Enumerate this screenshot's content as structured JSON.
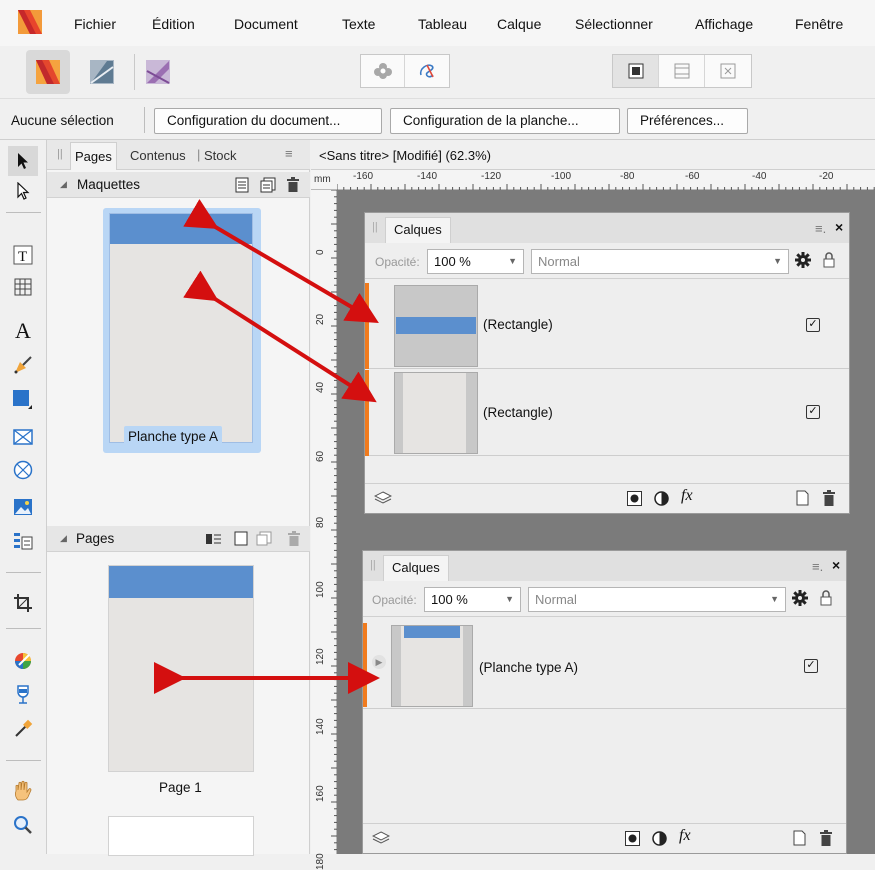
{
  "menubar": {
    "items": [
      "Fichier",
      "Édition",
      "Document",
      "Texte",
      "Tableau",
      "Calque",
      "Sélectionner",
      "Affichage",
      "Fenêtre"
    ]
  },
  "personas": [
    "publisher-icon",
    "designer-icon",
    "photo-icon"
  ],
  "contextbar": {
    "selection": "Aucune sélection",
    "buttons": [
      "Configuration du document...",
      "Configuration de la planche...",
      "Préférences..."
    ]
  },
  "pages_panel": {
    "tabs": [
      "Pages",
      "Contenus",
      "Stock"
    ],
    "masters_section": "Maquettes",
    "master_label": "Planche type A",
    "pages_section": "Pages",
    "page_label": "Page 1"
  },
  "document": {
    "tab_title": "<Sans titre> [Modifié] (62.3%)",
    "ruler_unit": "mm",
    "h_ticks": [
      "-160",
      "-140",
      "-120",
      "-100",
      "-80",
      "-60",
      "-40",
      "-20"
    ],
    "v_ticks": [
      "0",
      "20",
      "40",
      "60",
      "80",
      "100",
      "120",
      "140",
      "160",
      "180"
    ]
  },
  "calques_top": {
    "title": "Calques",
    "opacity_label": "Opacité:",
    "opacity_value": "100 %",
    "blend_mode": "Normal",
    "layers": [
      {
        "name": "(Rectangle)",
        "visible": true
      },
      {
        "name": "(Rectangle)",
        "visible": true
      }
    ]
  },
  "calques_bottom": {
    "title": "Calques",
    "opacity_label": "Opacité:",
    "opacity_value": "100 %",
    "blend_mode": "Normal",
    "layers": [
      {
        "name": "(Planche type A)",
        "visible": true
      }
    ]
  },
  "colors": {
    "accent_blue": "#5b8fce",
    "arrow_red": "#d40f0f",
    "orange_marker": "#f07b1e",
    "selection_blue": "#b9d6f5"
  }
}
